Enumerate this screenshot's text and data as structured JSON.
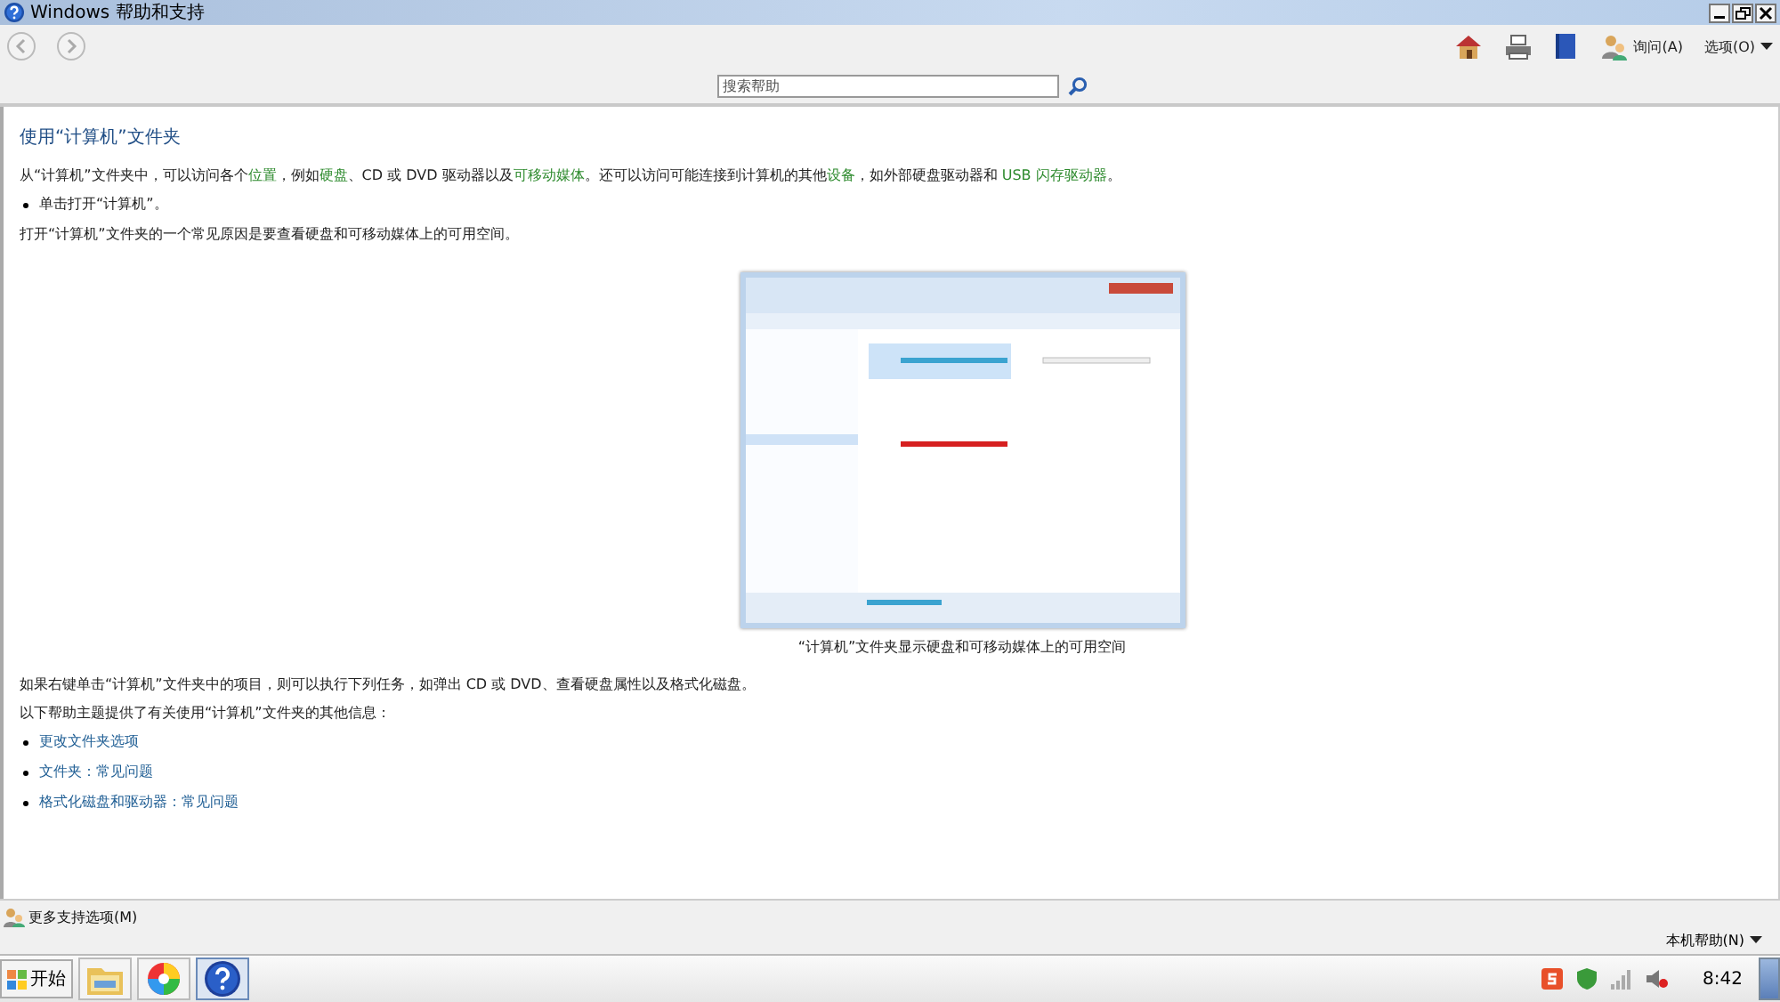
{
  "window": {
    "title": "Windows 帮助和支持"
  },
  "toolbar": {
    "items": [
      {
        "kind": "home"
      },
      {
        "kind": "print"
      },
      {
        "kind": "browse"
      },
      {
        "kind": "ask",
        "label": "询问(A)"
      },
      {
        "kind": "options",
        "label": "选项(O)"
      }
    ]
  },
  "search": {
    "placeholder": "搜索帮助"
  },
  "article": {
    "heading": "使用“计算机”文件夹",
    "intro": [
      {
        "text": "从“计算机”文件夹中，可以访问各个",
        "link": false
      },
      {
        "text": "位置",
        "link": true
      },
      {
        "text": "，例如",
        "link": false
      },
      {
        "text": "硬盘",
        "link": true
      },
      {
        "text": "、CD 或 DVD 驱动器以及",
        "link": false
      },
      {
        "text": "可移动媒体",
        "link": true
      },
      {
        "text": "。还可以访问可能连接到计算机的其他",
        "link": false
      },
      {
        "text": "设备",
        "link": true
      },
      {
        "text": "，如外部硬盘驱动器和 ",
        "link": false
      },
      {
        "text": "USB 闪存驱动器",
        "link": true
      },
      {
        "text": "。",
        "link": false
      }
    ],
    "steps": [
      "单击打开“计算机”。"
    ],
    "paragraph_2": "打开“计算机”文件夹的一个常见原因是要查看硬盘和可移动媒体上的可用空间。",
    "figure": {
      "kind": "picture",
      "caption": "“计算机”文件夹显示硬盘和可移动媒体上的可用空间"
    },
    "paragraph_3": "如果右键单击“计算机”文件夹中的项目，则可以执行下列任务，如弹出 CD 或 DVD、查看硬盘属性以及格式化磁盘。",
    "paragraph_4": "以下帮助主题提供了有关使用“计算机”文件夹的其他信息：",
    "links": [
      "更改文件夹选项",
      "文件夹：常见问题",
      "格式化磁盘和驱动器：常见问题"
    ]
  },
  "support_bar": {
    "label": "更多支持选项(M)"
  },
  "ime_bar": {
    "label": "本机帮助(N)"
  },
  "taskbar": {
    "start": "开始",
    "buttons": [
      {
        "kind": "folder",
        "selected": false
      },
      {
        "kind": "colors",
        "selected": false
      },
      {
        "kind": "help",
        "selected": true
      }
    ],
    "clock": "8:42"
  }
}
